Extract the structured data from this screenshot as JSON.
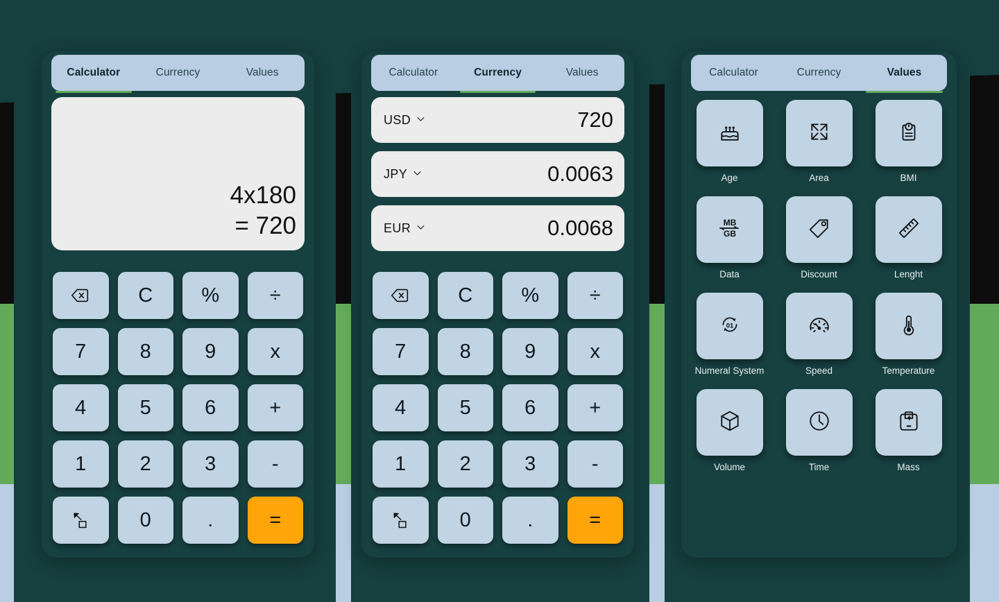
{
  "theme": {
    "page_bg": "#163f3f",
    "panel_bg": "#174040",
    "tabbar_bg": "#b9cee2",
    "accent_green": "#63ab5b",
    "accent_orange": "#ffa50a",
    "key_bg": "#c0d4e4",
    "display_bg": "#ececec",
    "stripe_black": "#0d0d0d",
    "stripe_green": "#63ab5b",
    "stripe_blue": "#b9cee2"
  },
  "tabs": [
    {
      "label": "Calculator"
    },
    {
      "label": "Currency"
    },
    {
      "label": "Values"
    }
  ],
  "panels": {
    "calculator": {
      "active_tab": "Calculator",
      "display": {
        "expression": "4x180",
        "result": "= 720"
      }
    },
    "currency": {
      "active_tab": "Currency",
      "rows": [
        {
          "code": "USD",
          "value": "720"
        },
        {
          "code": "JPY",
          "value": "0.0063"
        },
        {
          "code": "EUR",
          "value": "0.0068"
        }
      ]
    },
    "values": {
      "active_tab": "Values",
      "items": [
        {
          "label": "Age",
          "icon": "birthday-cake-icon"
        },
        {
          "label": "Area",
          "icon": "expand-arrows-icon"
        },
        {
          "label": "BMI",
          "icon": "clipboard-gauge-icon"
        },
        {
          "label": "Data",
          "icon": "mb-gb-icon"
        },
        {
          "label": "Discount",
          "icon": "price-tag-icon"
        },
        {
          "label": "Lenght",
          "icon": "ruler-icon"
        },
        {
          "label": "Numeral System",
          "icon": "binary-refresh-icon"
        },
        {
          "label": "Speed",
          "icon": "speedometer-icon"
        },
        {
          "label": "Temperature",
          "icon": "thermometer-icon"
        },
        {
          "label": "Volume",
          "icon": "cube-icon"
        },
        {
          "label": "Time",
          "icon": "clock-icon"
        },
        {
          "label": "Mass",
          "icon": "weight-scale-icon"
        }
      ]
    }
  },
  "keypad": [
    {
      "label": "",
      "icon": "backspace-icon",
      "kind": "icon"
    },
    {
      "label": "C",
      "icon": "",
      "kind": "text"
    },
    {
      "label": "%",
      "icon": "",
      "kind": "text"
    },
    {
      "label": "÷",
      "icon": "",
      "kind": "text"
    },
    {
      "label": "7",
      "icon": "",
      "kind": "text"
    },
    {
      "label": "8",
      "icon": "",
      "kind": "text"
    },
    {
      "label": "9",
      "icon": "",
      "kind": "text"
    },
    {
      "label": "x",
      "icon": "",
      "kind": "text"
    },
    {
      "label": "4",
      "icon": "",
      "kind": "text"
    },
    {
      "label": "5",
      "icon": "",
      "kind": "text"
    },
    {
      "label": "6",
      "icon": "",
      "kind": "text"
    },
    {
      "label": "+",
      "icon": "",
      "kind": "text"
    },
    {
      "label": "1",
      "icon": "",
      "kind": "text"
    },
    {
      "label": "2",
      "icon": "",
      "kind": "text"
    },
    {
      "label": "3",
      "icon": "",
      "kind": "text"
    },
    {
      "label": "-",
      "icon": "",
      "kind": "text"
    },
    {
      "label": "",
      "icon": "open-external-icon",
      "kind": "icon"
    },
    {
      "label": "0",
      "icon": "",
      "kind": "text"
    },
    {
      "label": ".",
      "icon": "",
      "kind": "text"
    },
    {
      "label": "=",
      "icon": "",
      "kind": "accent"
    }
  ]
}
